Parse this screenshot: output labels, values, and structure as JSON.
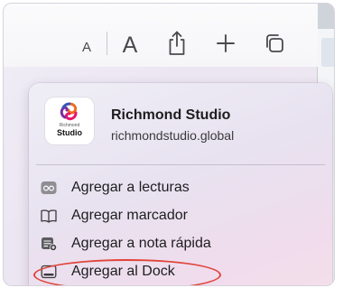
{
  "toolbar": {
    "font_small_label": "A",
    "font_large_label": "A",
    "share_icon": "share-icon",
    "new_tab_icon": "plus-icon",
    "tab_overview_icon": "tabs-icon"
  },
  "popover": {
    "site": {
      "name": "Richmond Studio",
      "domain": "richmondstudio.global",
      "logo_small_text": "Richmond",
      "logo_big_text": "Studio"
    },
    "items": [
      {
        "label": "Agregar a lecturas",
        "icon": "reading-list-icon"
      },
      {
        "label": "Agregar marcador",
        "icon": "bookmark-icon"
      },
      {
        "label": "Agregar a nota rápida",
        "icon": "quick-note-icon"
      },
      {
        "label": "Agregar al Dock",
        "icon": "dock-icon",
        "highlighted": true
      }
    ]
  },
  "colors": {
    "highlight_ring": "#e0443a",
    "logo_orange": "#f26a21",
    "logo_pink": "#e6176e",
    "logo_purple": "#7b2ca3",
    "logo_blue": "#3a55b4"
  }
}
